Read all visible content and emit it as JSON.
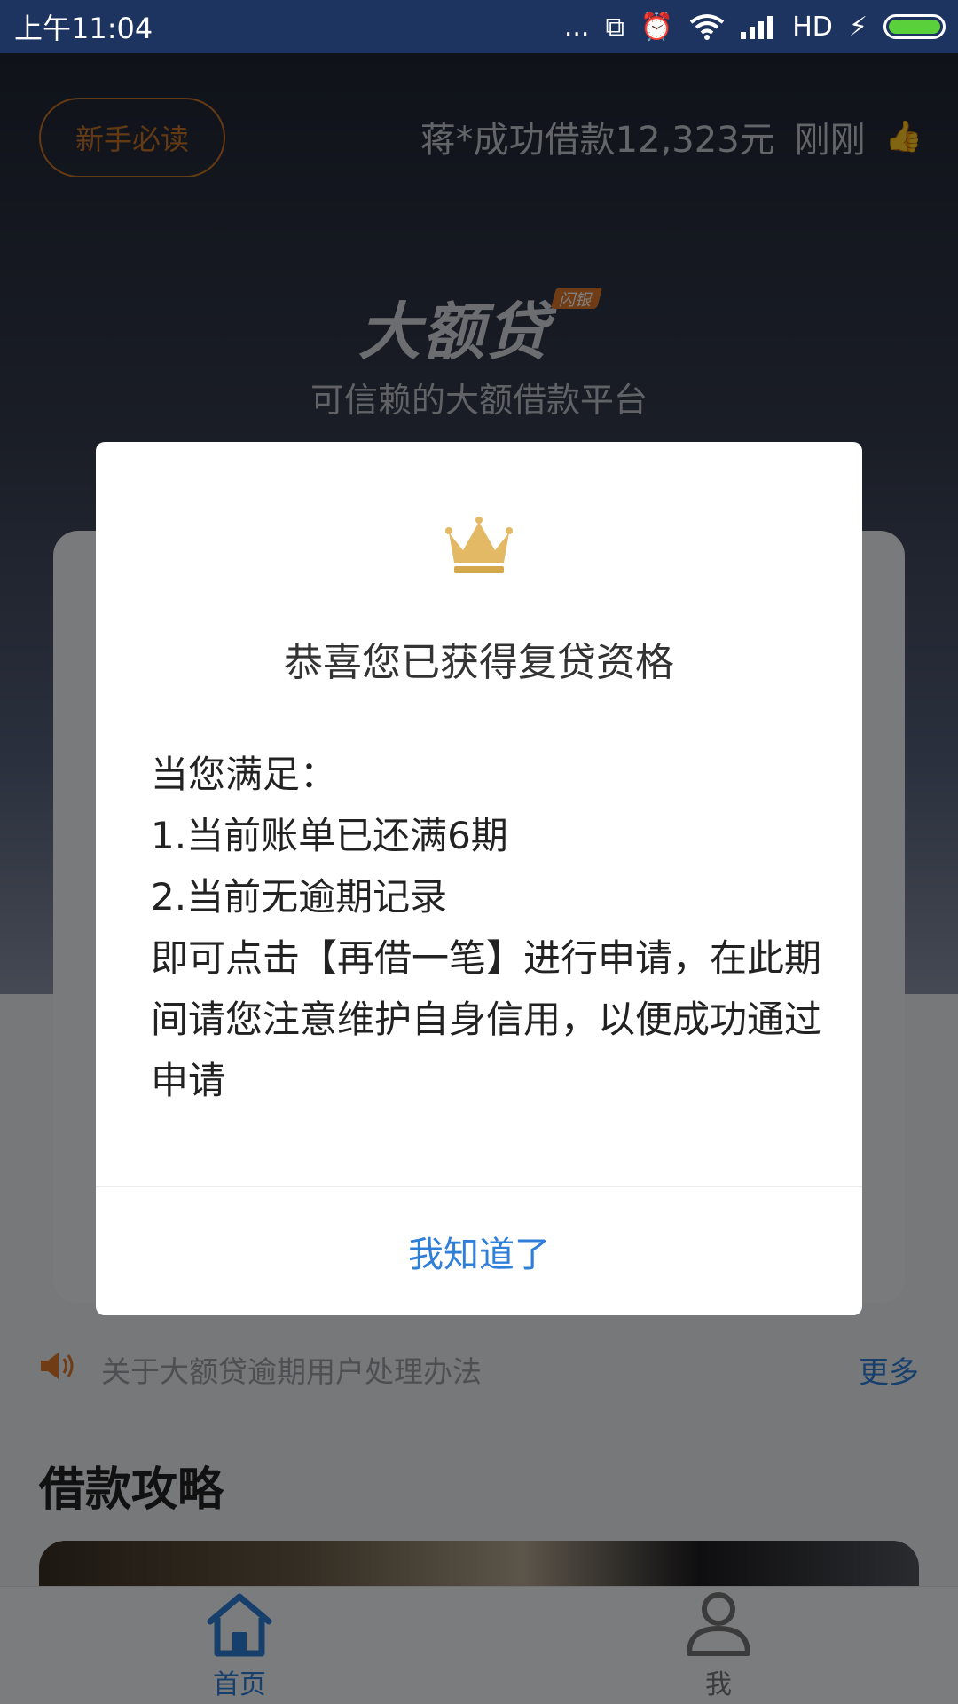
{
  "status_bar": {
    "time": "上午11:04",
    "network": "HD",
    "dots": "..."
  },
  "header": {
    "guide_button": "新手必读",
    "ticker_text": "蒋*成功借款12,323元",
    "ticker_time": "刚刚",
    "thumb_icon": "thumbs-up-icon"
  },
  "brand": {
    "logo_text": "大额贷",
    "logo_badge": "闪银",
    "slogan": "可信赖的大额借款平台"
  },
  "notice": {
    "text": "关于大额贷逾期用户处理办法",
    "more": "更多"
  },
  "section": {
    "title": "借款攻略"
  },
  "tab_bar": {
    "items": [
      {
        "label": "首页",
        "icon": "home-icon"
      },
      {
        "label": "我",
        "icon": "user-icon"
      }
    ]
  },
  "modal": {
    "icon": "crown-icon",
    "title": "恭喜您已获得复贷资格",
    "lines": [
      "当您满足：",
      "1.当前账单已还满6期",
      "2.当前无逾期记录",
      "即可点击【再借一笔】进行申请，在此期间请您注意维护自身信用，以便成功通过申请"
    ],
    "confirm": "我知道了"
  },
  "colors": {
    "accent_blue": "#2f7fd8",
    "accent_orange": "#e0782c",
    "gold": "#e3b965",
    "status_bar": "#1d3461"
  }
}
